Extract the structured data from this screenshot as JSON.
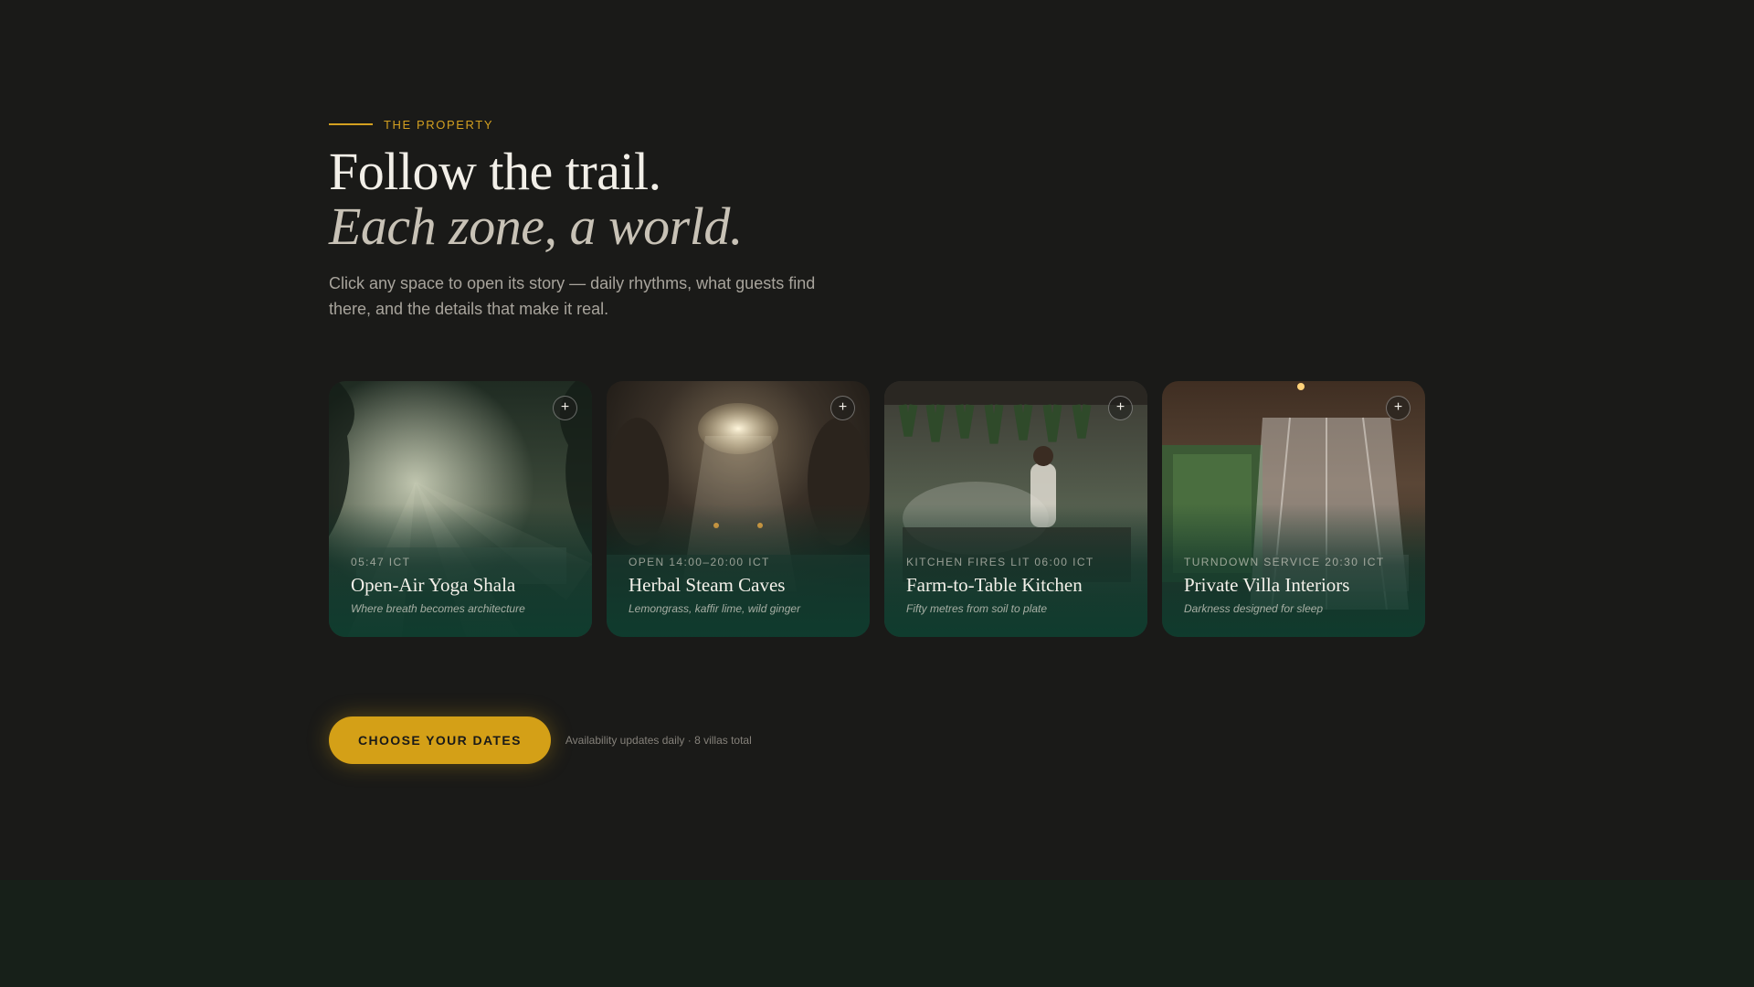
{
  "section": {
    "eyebrow": "The Property",
    "headline_line1": "Follow the trail.",
    "headline_line2": "Each zone, a world.",
    "intro": "Click any space to open its story — daily rhythms, what guests find there, and the details that make it real."
  },
  "cards": [
    {
      "meta": "05:47 ICT",
      "title": "Open-Air Yoga Shala",
      "subtitle": "Where breath becomes architecture",
      "open_label": "+"
    },
    {
      "meta": "Open 14:00–20:00 ICT",
      "title": "Herbal Steam Caves",
      "subtitle": "Lemongrass, kaffir lime, wild ginger",
      "open_label": "+"
    },
    {
      "meta": "Kitchen fires lit 06:00 ICT",
      "title": "Farm-to-Table Kitchen",
      "subtitle": "Fifty metres from soil to plate",
      "open_label": "+"
    },
    {
      "meta": "Turndown service 20:30 ICT",
      "title": "Private Villa Interiors",
      "subtitle": "Darkness designed for sleep",
      "open_label": "+"
    }
  ],
  "cta": {
    "label": "CHOOSE YOUR DATES",
    "note": "Availability updates daily · 8 villas total"
  },
  "colors": {
    "background": "#1a1a18",
    "accent": "#d4a017",
    "footer": "#172019"
  }
}
